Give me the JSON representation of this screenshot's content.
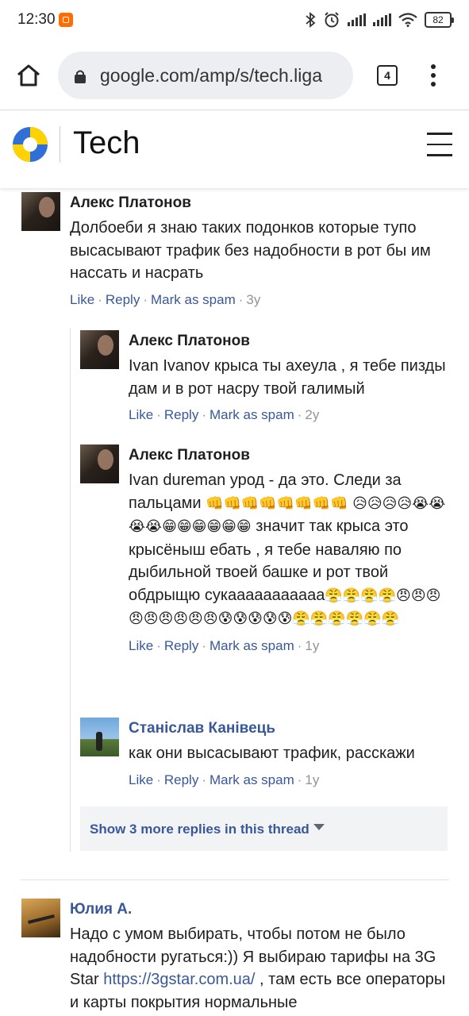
{
  "status": {
    "time": "12:30",
    "battery": "82"
  },
  "browser": {
    "url": "google.com/amp/s/tech.liga",
    "tabs_count": "4"
  },
  "site": {
    "title": "Tech"
  },
  "comments": [
    {
      "name": "Алекс Платонов",
      "text": "Долбоеби я знаю таких подонков которые тупо высасывают трафик без надобности в рот бы им нассать и насрать",
      "age": "3y"
    },
    {
      "name": "Алекс Платонов",
      "text": "Ivan Ivanov крыса ты ахеула , я тебе пизды дам и в рот насру твой галимый",
      "age": "2y"
    },
    {
      "name": "Алекс Платонов",
      "text_a": "Ivan dureman урод - да это. Следи за пальцами ",
      "emoji_a": "👊👊👊👊👊👊👊👊 😥😥😥😥😭😭😭😭😁😁😁😁😁😁",
      "text_b": " значит так крыса это крысёныш ебать , я тебе наваляю по дыбильной твоей башке и рот твой обдрыщю сукааааааааааа",
      "emoji_b": "😤😤😤😤😠😠😠😠😠😠😠😠😠😰😰😰😰😰😤😤😤😤😤😤",
      "age": "1y"
    },
    {
      "name": "Станіслав Канівець",
      "text": "как они высасывают трафик, расскажи",
      "age": "1y"
    },
    {
      "name": "Юлия А.",
      "text_a": "Надо с умом выбирать, чтобы потом не было надобности ругаться:)) Я выбираю тарифы на 3G Star ",
      "link": "https://3gstar.com.ua/",
      "text_b": " , там есть все операторы и карты покрытия нормальные"
    }
  ],
  "actions": {
    "like": "Like",
    "reply": "Reply",
    "spam": "Mark as spam"
  },
  "more_replies": "Show 3 more replies in this thread"
}
